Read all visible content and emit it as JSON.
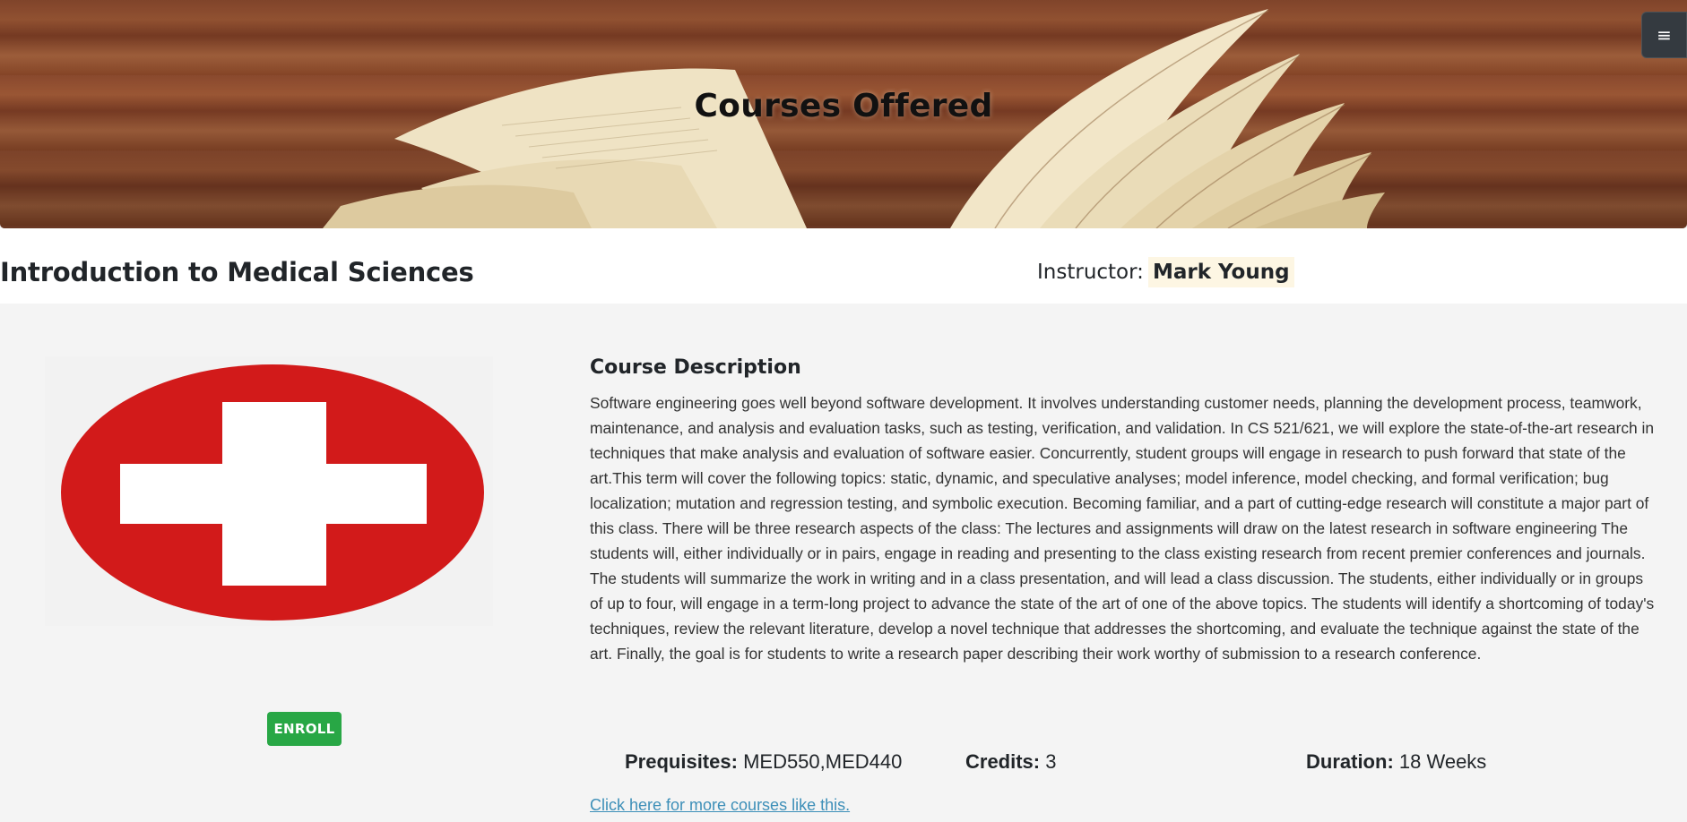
{
  "header": {
    "title": "Courses Offered",
    "menu_icon": "hamburger-menu-icon",
    "menu_glyph": "≡"
  },
  "course": {
    "title": "Introduction to Medical Sciences",
    "instructor_label": "Instructor:",
    "instructor_name": "Mark Young",
    "image_icon": "medical-cross-icon",
    "enroll_label": "ENROLL",
    "description_heading": "Course Description",
    "description": "Software engineering goes well beyond software development. It involves understanding customer needs, planning the development process, teamwork, maintenance, and analysis and evaluation tasks, such as testing, verification, and validation. In CS 521/621, we will explore the state-of-the-art research in techniques that make analysis and evaluation of software easier. Concurrently, student groups will engage in research to push forward that state of the art.This term will cover the following topics: static, dynamic, and speculative analyses; model inference, model checking, and formal verification; bug localization; mutation and regression testing, and symbolic execution. Becoming familiar, and a part of cutting-edge research will constitute a major part of this class. There will be three research aspects of the class: The lectures and assignments will draw on the latest research in software engineering The students will, either individually or in pairs, engage in reading and presenting to the class existing research from recent premier conferences and journals. The students will summarize the work in writing and in a class presentation, and will lead a class discussion. The students, either individually or in groups of up to four, will engage in a term-long project to advance the state of the art of one of the above topics. The students will identify a shortcoming of today's techniques, review the relevant literature, develop a novel technique that addresses the shortcoming, and evaluate the technique against the state of the art. Finally, the goal is for students to write a research paper describing their work worthy of submission to a research conference.",
    "prerequisites_label": "Prequisites:",
    "prerequisites_value": "MED550,MED440",
    "credits_label": "Credits:",
    "credits_value": "3",
    "duration_label": "Duration:",
    "duration_value": "18 Weeks",
    "more_link": "Click here for more courses like this."
  },
  "colors": {
    "enroll_button": "#28a745",
    "cross_red": "#d21a1a",
    "link": "#3d8fb8",
    "instructor_highlight": "#fdf6e3",
    "menu_button": "#343a40"
  }
}
